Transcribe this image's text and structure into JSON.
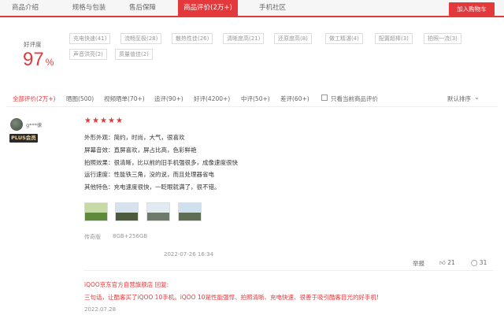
{
  "tabs": [
    {
      "label": "商品介绍",
      "active": false
    },
    {
      "label": "规格与包装",
      "active": false
    },
    {
      "label": "售后保障",
      "active": false
    },
    {
      "label": "商品评价(2万+)",
      "active": true
    },
    {
      "label": "手机社区",
      "active": false
    }
  ],
  "cart_button": "加入购物车",
  "rating": {
    "label": "好评度",
    "value": "97",
    "unit": "%"
  },
  "tags": [
    "充电快速(41)",
    "流畅至极(28)",
    "散热性佳(26)",
    "清晰度高(21)",
    "还原度高(8)",
    "做工精湛(4)",
    "配置超棒(3)",
    "拍照一流(3)",
    "声音洪亮(2)",
    "质量值佳(2)"
  ],
  "filters": [
    {
      "label": "全部评价(2万+)",
      "active": true
    },
    {
      "label": "晒图(500)",
      "active": false
    },
    {
      "label": "视频晒单(70+)",
      "active": false
    },
    {
      "label": "追评(90+)",
      "active": false
    },
    {
      "label": "好评(4200+)",
      "active": false
    },
    {
      "label": "中评(50+)",
      "active": false
    },
    {
      "label": "差评(60+)",
      "active": false
    }
  ],
  "only_current_label": "只看当前商品评价",
  "sort_label": "默认排序",
  "review": {
    "username": "g***徕",
    "badge": "PLUS会员",
    "stars": 5,
    "lines": [
      "外形外观：简约，时尚，大气，很喜欢",
      "屏幕音效：直屏喜欢，屏占比高，色彩鲜艳",
      "拍照效果：很清晰，比以前的旧手机强很多，成像速度很快",
      "运行速度：性能铁三角，没的说，而且处理器省电",
      "其他特色：充电速度很快，一眨眼就满了，很不错。"
    ],
    "variant": "传奇版",
    "storage": "8GB+256GB",
    "date": "2022-07-26 16:34",
    "report_label": "举报",
    "like_count": "21",
    "comment_count": "31"
  },
  "reply": {
    "head": "iQOO京东官方自营旗舰店 回复:",
    "body": "三句话，让酷客买了iQOO 10手机。iQOO 10是性能强悍、拍照清晰、充电快速、很善于吸引酷客目光的好手机!",
    "date": "2022.07.28"
  },
  "colors": {
    "accent": "#e4393c"
  }
}
